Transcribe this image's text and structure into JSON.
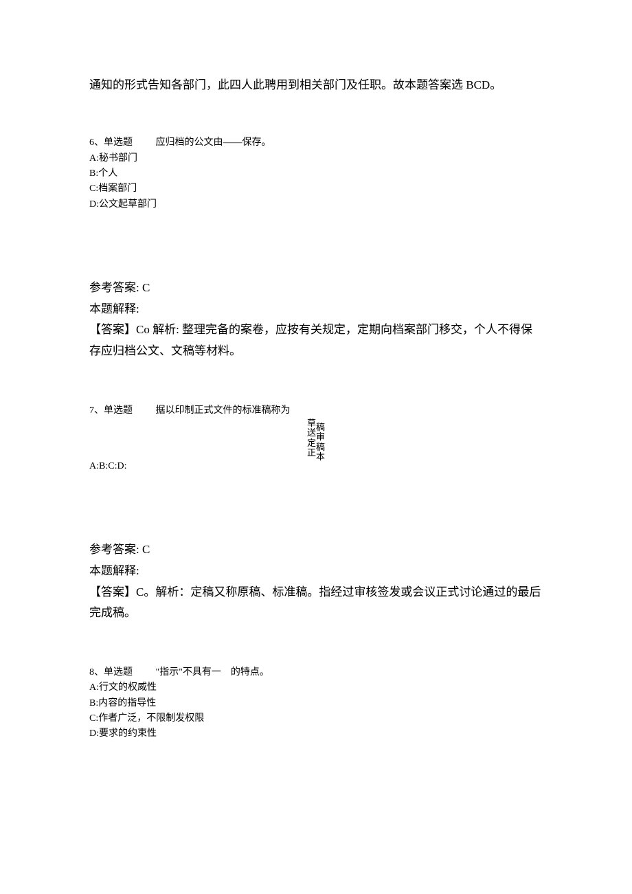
{
  "continuation": "通知的形式告知各部门，此四人此聘用到相关部门及任职。故本题答案选 BCD。",
  "q6": {
    "number": "6、单选题",
    "text": "应归档的公文由――保存。",
    "optionA": "A:秘书部门",
    "optionB": "B:个人",
    "optionC": "C:档案部门",
    "optionD": "D:公文起草部门",
    "answerLabel": "参考答案: C",
    "explainLabel": "本题解释:",
    "explanation": "【答案】Co 解析: 整理完备的案卷，应按有关规定，定期向档案部门移交，个人不得保存应归档公文、文稿等材料。"
  },
  "q7": {
    "number": "7、单选题",
    "text": "据以印制正式文件的标准稿称为",
    "opt_r1a": "草",
    "opt_r1b": "稿",
    "opt_r2a": "送",
    "opt_r2b": "审",
    "opt_r3a": "定",
    "opt_r3b": "稿",
    "opt_r4a": "正",
    "opt_r4b": "本",
    "abcd": "A:B:C:D:",
    "answerLabel": "参考答案: C",
    "explainLabel": "本题解释:",
    "explanation": "【答案】C。解析：定稿又称原稿、标准稿。指经过审核签发或会议正式讨论通过的最后完成稿。"
  },
  "q8": {
    "number": "8、单选题",
    "text": "\"指示\"不具有一　的特点。",
    "optionA": "A:行文的权威性",
    "optionB": "B:内容的指导性",
    "optionC": "C:作者广泛，不限制发权限",
    "optionD": "D:要求的约束性"
  }
}
